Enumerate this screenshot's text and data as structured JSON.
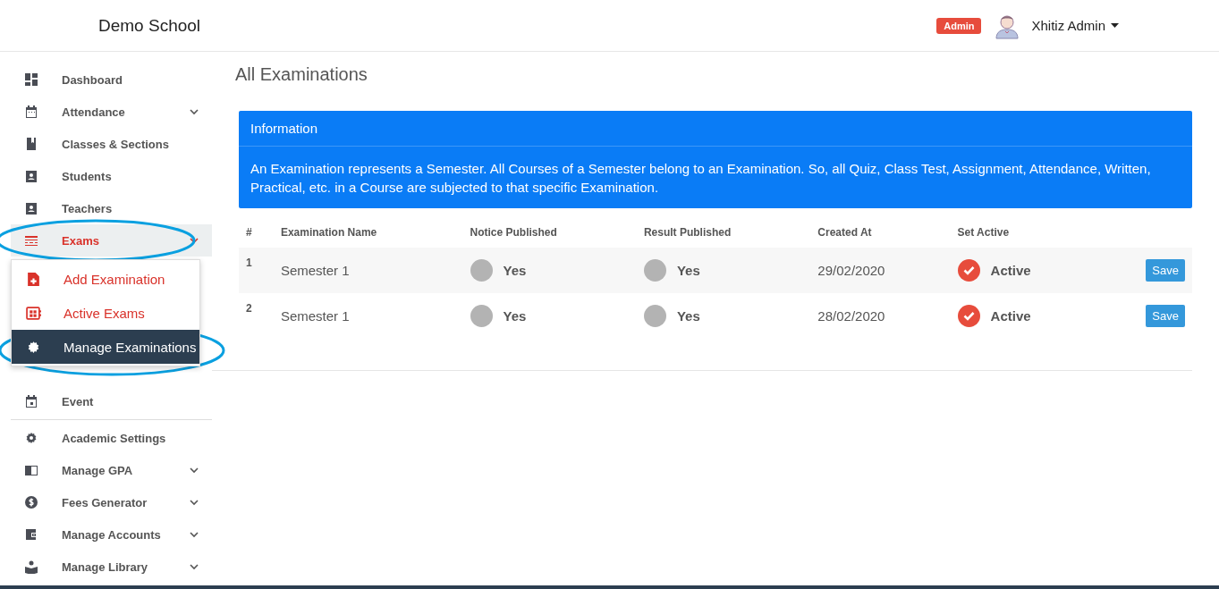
{
  "header": {
    "brand": "Demo School",
    "role_badge": "Admin",
    "user_name": "Xhitiz Admin"
  },
  "sidebar": {
    "items": [
      {
        "label": "Dashboard",
        "expandable": false,
        "selected": false
      },
      {
        "label": "Attendance",
        "expandable": true,
        "selected": false
      },
      {
        "label": "Classes & Sections",
        "expandable": false,
        "selected": false
      },
      {
        "label": "Students",
        "expandable": false,
        "selected": false
      },
      {
        "label": "Teachers",
        "expandable": false,
        "selected": false
      },
      {
        "label": "Exams",
        "expandable": true,
        "selected": true,
        "expanded": true,
        "children": [
          {
            "label": "Add Examination",
            "selected": false
          },
          {
            "label": "Active Exams",
            "selected": false
          },
          {
            "label": "Manage Examinations",
            "selected": true
          }
        ]
      },
      {
        "label": "Event",
        "expandable": false,
        "selected": false
      },
      {
        "label": "Academic Settings",
        "expandable": false,
        "selected": false
      },
      {
        "label": "Manage GPA",
        "expandable": true,
        "selected": false
      },
      {
        "label": "Fees Generator",
        "expandable": true,
        "selected": false
      },
      {
        "label": "Manage Accounts",
        "expandable": true,
        "selected": false
      },
      {
        "label": "Manage Library",
        "expandable": true,
        "selected": false
      }
    ]
  },
  "page_title": "All Examinations",
  "info": {
    "title": "Information",
    "text": "An Examination represents a Semester. All Courses of a Semester belong to an Examination. So, all Quiz, Class Test, Assignment, Attendance, Written, Practical, etc. in a Course are subjected to that specific Examination."
  },
  "table": {
    "columns": [
      "#",
      "Examination Name",
      "Notice Published",
      "Result Published",
      "Created At",
      "Set Active"
    ],
    "rows": [
      {
        "index": "1",
        "name": "Semester 1",
        "notice": "Yes",
        "result": "Yes",
        "created": "29/02/2020",
        "active_label": "Active",
        "active": true,
        "action": "Save"
      },
      {
        "index": "2",
        "name": "Semester 1",
        "notice": "Yes",
        "result": "Yes",
        "created": "28/02/2020",
        "active_label": "Active",
        "active": true,
        "action": "Save"
      }
    ]
  }
}
